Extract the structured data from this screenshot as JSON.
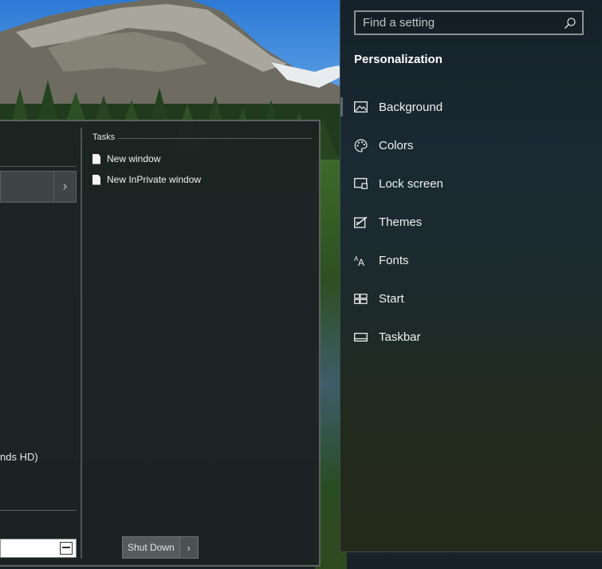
{
  "start_menu": {
    "tasks_header": "Tasks",
    "tasks": [
      "New window",
      "New InPrivate window"
    ],
    "left_partial_text": "nds HD)",
    "shutdown_label": "Shut Down"
  },
  "settings": {
    "search_placeholder": "Find a setting",
    "section_title": "Personalization",
    "nav_items": [
      {
        "label": "Background",
        "icon": "image-icon"
      },
      {
        "label": "Colors",
        "icon": "palette-icon"
      },
      {
        "label": "Lock screen",
        "icon": "lock-screen-icon"
      },
      {
        "label": "Themes",
        "icon": "themes-icon"
      },
      {
        "label": "Fonts",
        "icon": "fonts-icon"
      },
      {
        "label": "Start",
        "icon": "start-icon"
      },
      {
        "label": "Taskbar",
        "icon": "taskbar-icon"
      }
    ]
  }
}
